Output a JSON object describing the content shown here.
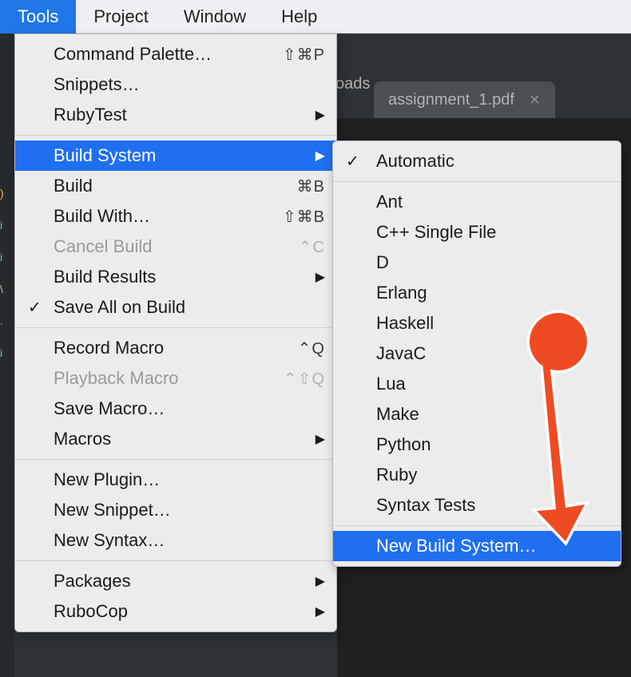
{
  "menubar": {
    "tools": "Tools",
    "project": "Project",
    "window": "Window",
    "help": "Help"
  },
  "background": {
    "path_fragment": "oads",
    "tab_name": "assignment_1.pdf"
  },
  "tools_menu": {
    "command_palette": "Command Palette…",
    "command_palette_sc": "⇧⌘P",
    "snippets": "Snippets…",
    "rubytest": "RubyTest",
    "build_system": "Build System",
    "build": "Build",
    "build_sc": "⌘B",
    "build_with": "Build With…",
    "build_with_sc": "⇧⌘B",
    "cancel_build": "Cancel Build",
    "cancel_build_sc": "⌃C",
    "build_results": "Build Results",
    "save_all_on_build": "Save All on Build",
    "record_macro": "Record Macro",
    "record_macro_sc": "⌃Q",
    "playback_macro": "Playback Macro",
    "playback_macro_sc": "⌃⇧Q",
    "save_macro": "Save Macro…",
    "macros": "Macros",
    "new_plugin": "New Plugin…",
    "new_snippet": "New Snippet…",
    "new_syntax": "New Syntax…",
    "packages": "Packages",
    "rubocop": "RuboCop"
  },
  "build_system_submenu": {
    "automatic": "Automatic",
    "ant": "Ant",
    "cpp": "C++ Single File",
    "d": "D",
    "erlang": "Erlang",
    "haskell": "Haskell",
    "javac": "JavaC",
    "lua": "Lua",
    "make": "Make",
    "python": "Python",
    "ruby": "Ruby",
    "syntax_tests": "Syntax Tests",
    "new_build_system": "New Build System…"
  },
  "annotation": {
    "arrow_color": "#ef4b23"
  }
}
